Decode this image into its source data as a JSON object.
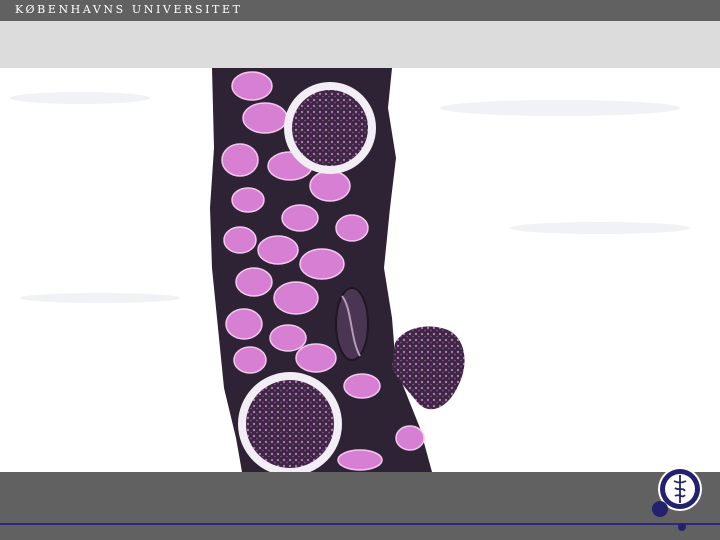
{
  "header": {
    "brand_text": "KØBENHAVNS UNIVERSITET"
  },
  "slide": {
    "title": "",
    "image_subject": "kidney-biopsy-micrograph"
  },
  "logo": {
    "name": "university-seal-icon"
  },
  "colors": {
    "header_bar": "#616161",
    "title_band": "#dcdcdc",
    "footer_bar": "#616161",
    "accent_navy": "#24216e",
    "tissue_pink": "#d77fd2",
    "tissue_dark": "#3a2840"
  }
}
